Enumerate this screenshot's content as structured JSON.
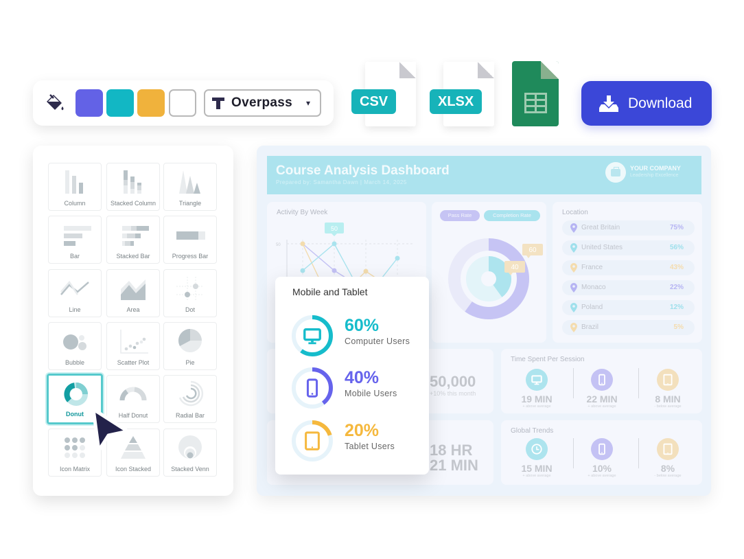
{
  "toolbar": {
    "swatches": [
      {
        "name": "purple",
        "color": "#6362e6"
      },
      {
        "name": "teal",
        "color": "#12b7c4"
      },
      {
        "name": "amber",
        "color": "#f0b23c"
      },
      {
        "name": "white",
        "color": "#ffffff"
      }
    ],
    "font_label": "Overpass",
    "icon_paint": "paint-bucket-icon",
    "icon_font": "text-t-icon",
    "icon_chevron": "chevron-down-icon"
  },
  "exports": {
    "csv_label": "CSV",
    "xlsx_label": "XLSX",
    "sheets_icon": "google-sheets-icon",
    "download_label": "Download",
    "download_icon": "download-tray-icon",
    "accent": "#3b47d8",
    "badge_color": "#17b3b9"
  },
  "picker": {
    "selected": "Donut",
    "tiles": [
      {
        "label": "Column",
        "icon": "column-chart-icon"
      },
      {
        "label": "Stacked Column",
        "icon": "stacked-column-icon"
      },
      {
        "label": "Triangle",
        "icon": "triangle-chart-icon"
      },
      {
        "label": "Bar",
        "icon": "bar-chart-icon"
      },
      {
        "label": "Stacked Bar",
        "icon": "stacked-bar-icon"
      },
      {
        "label": "Progress Bar",
        "icon": "progress-bar-icon"
      },
      {
        "label": "Line",
        "icon": "line-chart-icon"
      },
      {
        "label": "Area",
        "icon": "area-chart-icon"
      },
      {
        "label": "Dot",
        "icon": "dot-chart-icon"
      },
      {
        "label": "Bubble",
        "icon": "bubble-chart-icon"
      },
      {
        "label": "Scatter Plot",
        "icon": "scatter-plot-icon"
      },
      {
        "label": "Pie",
        "icon": "pie-chart-icon"
      },
      {
        "label": "Donut",
        "icon": "donut-chart-icon"
      },
      {
        "label": "Half Donut",
        "icon": "half-donut-icon"
      },
      {
        "label": "Radial Bar",
        "icon": "radial-bar-icon"
      },
      {
        "label": "Icon Matrix",
        "icon": "icon-matrix-icon"
      },
      {
        "label": "Icon Stacked",
        "icon": "icon-stacked-icon"
      },
      {
        "label": "Stacked Venn",
        "icon": "stacked-venn-icon"
      }
    ]
  },
  "dashboard": {
    "title": "Course Analysis Dashboard",
    "subtitle": "Prepared by:  Samantha Dawn | March 14, 2025",
    "company": "YOUR COMPANY",
    "tagline": "Leadership Excellence",
    "activity": {
      "title": "Activity By Week",
      "y_tick": "50",
      "callout": "50"
    },
    "rates": {
      "pass_label": "Pass Rate",
      "completion_label": "Completion Rate",
      "pass_value": 60,
      "completion_value": 40,
      "pass_callout": "60",
      "completion_callout": "40"
    },
    "location": {
      "title": "Location",
      "rows": [
        {
          "country": "Great Britain",
          "pct": "75%",
          "color": "#b6b4f3"
        },
        {
          "country": "United States",
          "pct": "56%",
          "color": "#9fe0ec"
        },
        {
          "country": "France",
          "pct": "43%",
          "color": "#f4dcae"
        },
        {
          "country": "Monaco",
          "pct": "22%",
          "color": "#b6b4f3"
        },
        {
          "country": "Poland",
          "pct": "12%",
          "color": "#9fe0ec"
        },
        {
          "country": "Brazil",
          "pct": "5%",
          "color": "#f4dcae"
        }
      ]
    },
    "users_total": {
      "value": "50,000",
      "note": "+10% this month"
    },
    "time_total": {
      "line1": "18 HR",
      "line2": "21 MIN"
    },
    "time_per_session": {
      "title": "Time Spent Per Session",
      "items": [
        {
          "value": "19 MIN",
          "note": "+ above average",
          "icon": "monitor-icon",
          "color": "#ade4ee"
        },
        {
          "value": "22 MIN",
          "note": "+ above average",
          "icon": "phone-icon",
          "color": "#c4c2f4"
        },
        {
          "value": "8 MIN",
          "note": "- below average",
          "icon": "tablet-icon",
          "color": "#f3e0bd"
        }
      ]
    },
    "global_trends": {
      "title": "Global Trends",
      "items": [
        {
          "value": "15 MIN",
          "note": "+ above average",
          "icon": "clock-icon",
          "color": "#ade4ee"
        },
        {
          "value": "10%",
          "note": "+ above average",
          "icon": "phone-icon",
          "color": "#c4c2f4"
        },
        {
          "value": "8%",
          "note": "- below average",
          "icon": "tablet-icon",
          "color": "#f3e0bd"
        }
      ]
    }
  },
  "overlay": {
    "title": "Mobile and Tablet",
    "rows": [
      {
        "pct": "60%",
        "fraction": 0.6,
        "label": "Computer Users",
        "color": "#16bccb",
        "icon": "monitor-icon"
      },
      {
        "pct": "40%",
        "fraction": 0.4,
        "label": "Mobile Users",
        "color": "#6663ec",
        "icon": "phone-icon"
      },
      {
        "pct": "20%",
        "fraction": 0.2,
        "label": "Tablet Users",
        "color": "#f5b83d",
        "icon": "tablet-icon"
      }
    ]
  }
}
